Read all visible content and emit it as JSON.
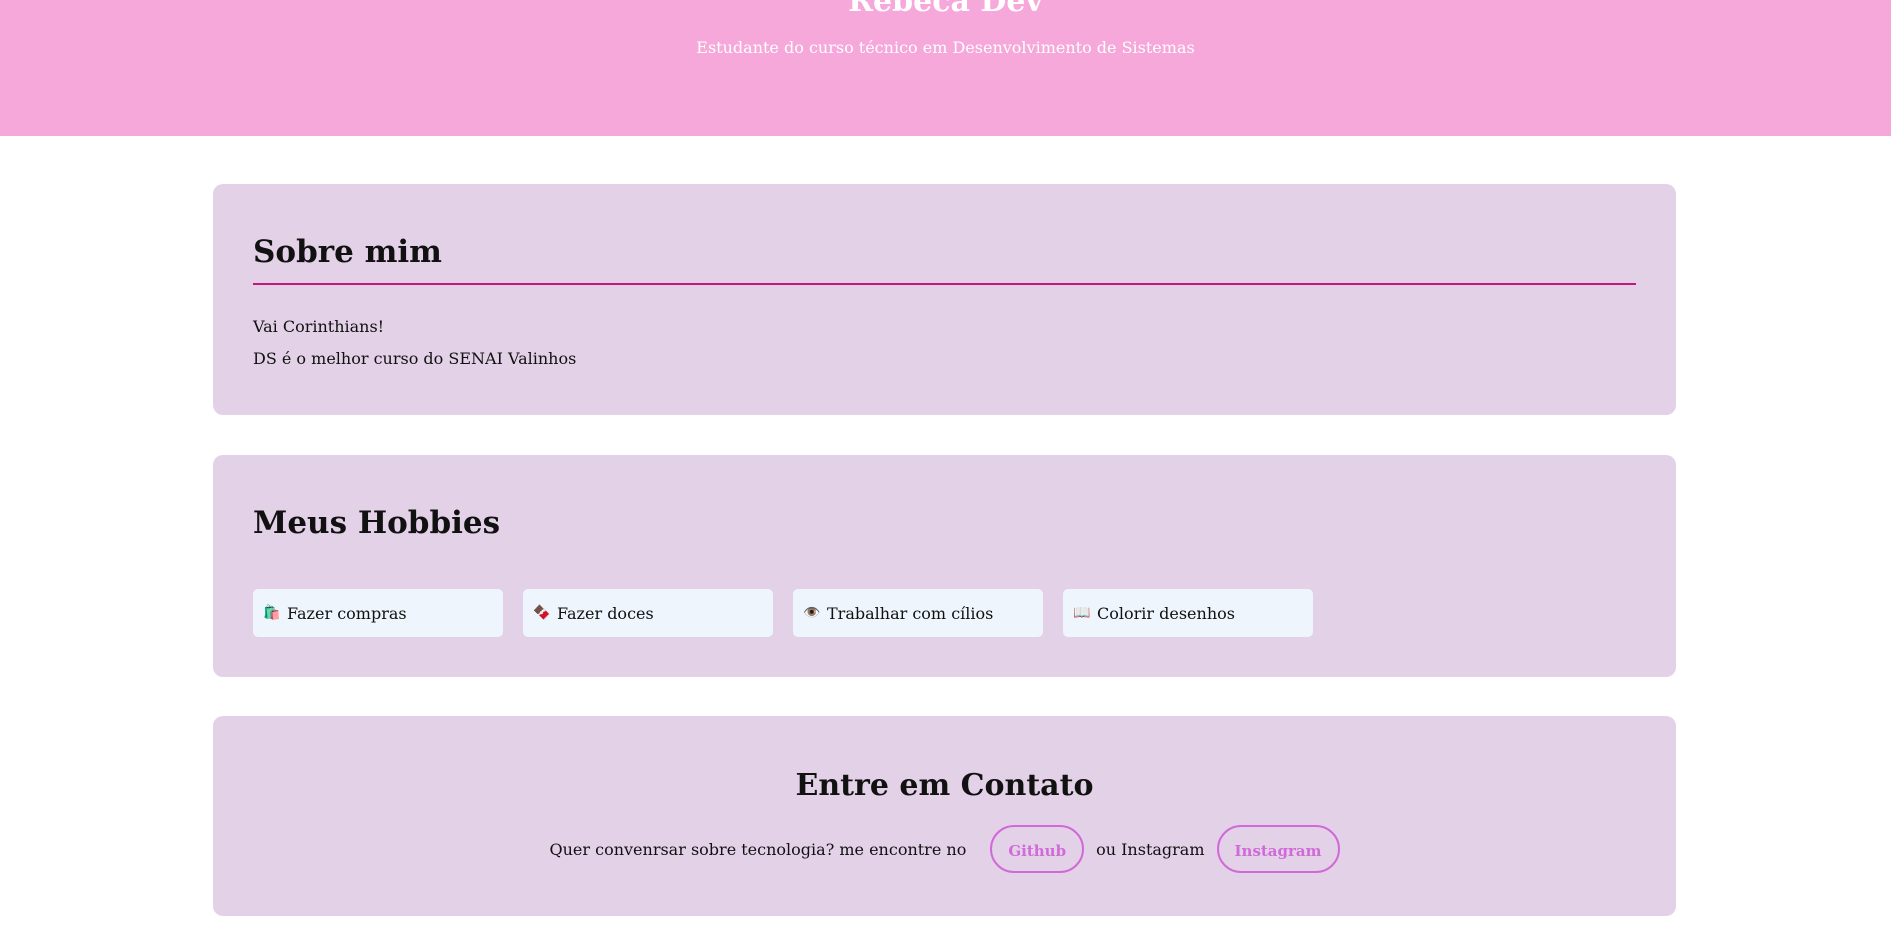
{
  "hero": {
    "title": "Rebeca Dev",
    "subtitle": "Estudante do curso técnico em Desenvolvimento de Sistemas",
    "background": "#f6a8db"
  },
  "about": {
    "title": "Sobre mim",
    "lines": [
      "Vai Corinthians!",
      "DS é o melhor curso do SENAI Valinhos"
    ],
    "accent": "#c7157f"
  },
  "hobbies": {
    "title": "Meus Hobbies",
    "items": [
      {
        "icon": "🛍️",
        "icon_name": "shopping-bag-icon",
        "label": "Fazer compras"
      },
      {
        "icon": "🍫",
        "icon_name": "chocolate-icon",
        "label": "Fazer doces"
      },
      {
        "icon": "👁️",
        "icon_name": "eye-icon",
        "label": "Trabalhar com cílios"
      },
      {
        "icon": "📖",
        "icon_name": "book-icon",
        "label": "Colorir desenhos"
      }
    ]
  },
  "contact": {
    "title": "Entre em Contato",
    "text_before": "Quer convenrsar sobre tecnologia? me encontre no",
    "github_label": "Github",
    "text_middle": "ou Instagram",
    "instagram_label": "Instagram",
    "link_color": "#d16ad8"
  },
  "card_background": "#e3d1e8"
}
